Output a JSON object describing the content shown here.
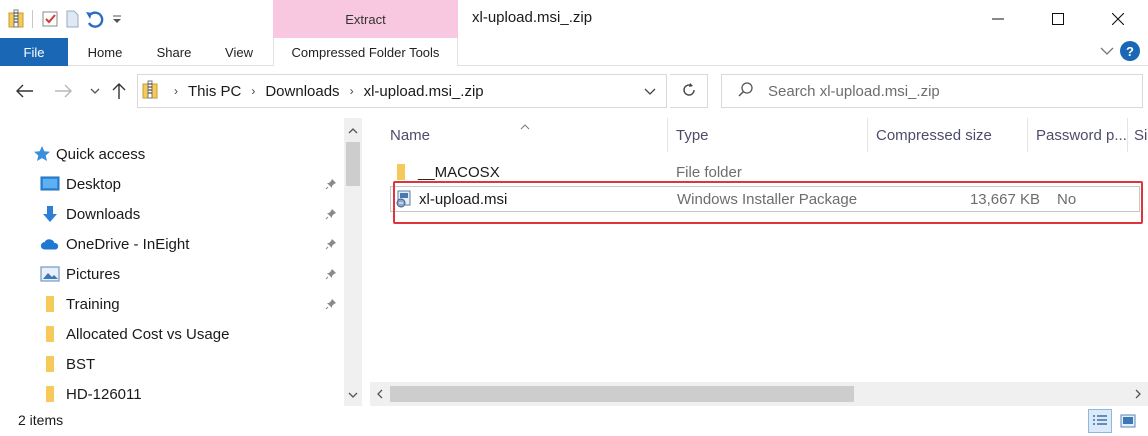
{
  "window": {
    "title": "xl-upload.msi_.zip",
    "context_tab_group": "Extract",
    "controls": {
      "minimize_icon": "minimize-icon",
      "maximize_icon": "maximize-icon",
      "close_icon": "close-icon"
    }
  },
  "quick_access_toolbar": {
    "icons": [
      "zip-folder-icon",
      "properties-check-icon",
      "new-folder-icon",
      "undo-icon",
      "customize-dropdown-icon"
    ]
  },
  "ribbon": {
    "tabs": [
      {
        "label": "File"
      },
      {
        "label": "Home"
      },
      {
        "label": "Share"
      },
      {
        "label": "View"
      },
      {
        "label": "Compressed Folder Tools"
      }
    ]
  },
  "address_bar": {
    "breadcrumbs": [
      "This PC",
      "Downloads",
      "xl-upload.msi_.zip"
    ]
  },
  "search": {
    "placeholder": "Search xl-upload.msi_.zip"
  },
  "nav_pane": {
    "quick_access": "Quick access",
    "items": [
      {
        "label": "Desktop",
        "icon": "desktop-icon",
        "pinned": true
      },
      {
        "label": "Downloads",
        "icon": "downloads-arrow-icon",
        "pinned": true
      },
      {
        "label": "OneDrive - InEight",
        "icon": "onedrive-cloud-icon",
        "pinned": true
      },
      {
        "label": "Pictures",
        "icon": "pictures-icon",
        "pinned": true
      },
      {
        "label": "Training",
        "icon": "folder-icon",
        "pinned": true
      },
      {
        "label": "Allocated Cost vs Usage",
        "icon": "folder-icon",
        "pinned": false
      },
      {
        "label": "BST",
        "icon": "folder-icon",
        "pinned": false
      },
      {
        "label": "HD-126011",
        "icon": "folder-icon",
        "pinned": false
      }
    ]
  },
  "file_list": {
    "columns": [
      "Name",
      "Type",
      "Compressed size",
      "Password p...",
      "Si"
    ],
    "rows": [
      {
        "name": "__MACOSX",
        "type": "File folder",
        "size": "",
        "password": ""
      },
      {
        "name": "xl-upload.msi",
        "type": "Windows Installer Package",
        "size": "13,667 KB",
        "password": "No"
      }
    ]
  },
  "status_bar": {
    "item_count": "2 items"
  },
  "colors": {
    "file_tab": "#1a67b5",
    "context_tab": "#f7c8df",
    "highlight_box": "#e0333a",
    "folder": "#f5c95a"
  }
}
